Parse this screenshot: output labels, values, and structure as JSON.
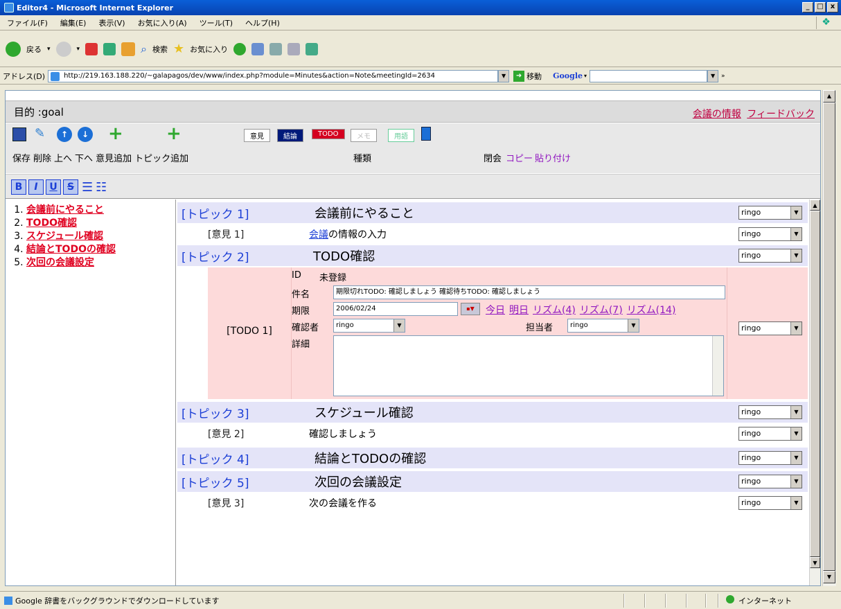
{
  "window": {
    "title": "Editor4 - Microsoft Internet Explorer",
    "minimize": "_",
    "maximize": "□",
    "close": "x"
  },
  "menu": [
    "ファイル(F)",
    "編集(E)",
    "表示(V)",
    "お気に入り(A)",
    "ツール(T)",
    "ヘルプ(H)"
  ],
  "toolbar": {
    "back": "戻る",
    "search": "検索",
    "favorites": "お気に入り"
  },
  "address": {
    "label": "アドレス(D)",
    "url": "http://219.163.188.220/~galapagos/dev/www/index.php?module=Minutes&action=Note&meetingId=2634",
    "go": "移動",
    "google": "Google"
  },
  "app": {
    "goal": "目的 :goal",
    "links": {
      "meeting_info": "会議の情報",
      "feedback": "フィードバック"
    },
    "tools": {
      "labels": [
        "保存",
        "削除",
        "上へ",
        "下へ",
        "意見追加",
        "トピック追加"
      ],
      "kind_label": "種類",
      "close_label": "閉会",
      "copy": "コピー",
      "paste": "貼り付け",
      "tags": [
        "意見",
        "結論",
        "TODO",
        "メモ",
        "用語"
      ]
    },
    "format": [
      "B",
      "I",
      "U",
      "S"
    ],
    "outline": [
      "会議前にやること",
      "TODO確認",
      "スケジュール確認",
      "結論とTODOの確認",
      "次回の会議設定"
    ],
    "rows": [
      {
        "kind": "topic",
        "label": "[トピック 1]",
        "title": "会議前にやること",
        "who": "ringo"
      },
      {
        "kind": "opinion",
        "label": "[意見 1]",
        "title_link": "会議",
        "title": "の情報の入力",
        "who": "ringo"
      },
      {
        "kind": "topic",
        "label": "[トピック 2]",
        "title": "TODO確認",
        "who": "ringo"
      },
      {
        "kind": "topic",
        "label": "[トピック 3]",
        "title": "スケジュール確認",
        "who": "ringo"
      },
      {
        "kind": "opinion",
        "label": "[意見 2]",
        "title": "確認しましょう",
        "who": "ringo"
      },
      {
        "kind": "topic",
        "label": "[トピック 4]",
        "title": "結論とTODOの確認",
        "who": "ringo"
      },
      {
        "kind": "topic",
        "label": "[トピック 5]",
        "title": "次回の会議設定",
        "who": "ringo"
      },
      {
        "kind": "opinion",
        "label": "[意見 3]",
        "title": "次の会議を作る",
        "who": "ringo"
      }
    ],
    "todo": {
      "label": "[TODO 1]",
      "id_label": "ID",
      "id_value": "未登録",
      "name_label": "件名",
      "name_value": "期限切れTODO: 確認しましょう 確認待ちTODO: 確認しましょう",
      "due_label": "期限",
      "due_value": "2006/02/24",
      "due_links": [
        "今日",
        "明日",
        "リズム(4)",
        "リズム(7)",
        "リズム(14)"
      ],
      "checker_label": "確認者",
      "checker_value": "ringo",
      "assignee_label": "担当者",
      "assignee_value": "ringo",
      "detail_label": "詳細",
      "who": "ringo"
    }
  },
  "status": {
    "text": "Google 辞書をバックグラウンドでダウンロードしています",
    "zone": "インターネット"
  }
}
